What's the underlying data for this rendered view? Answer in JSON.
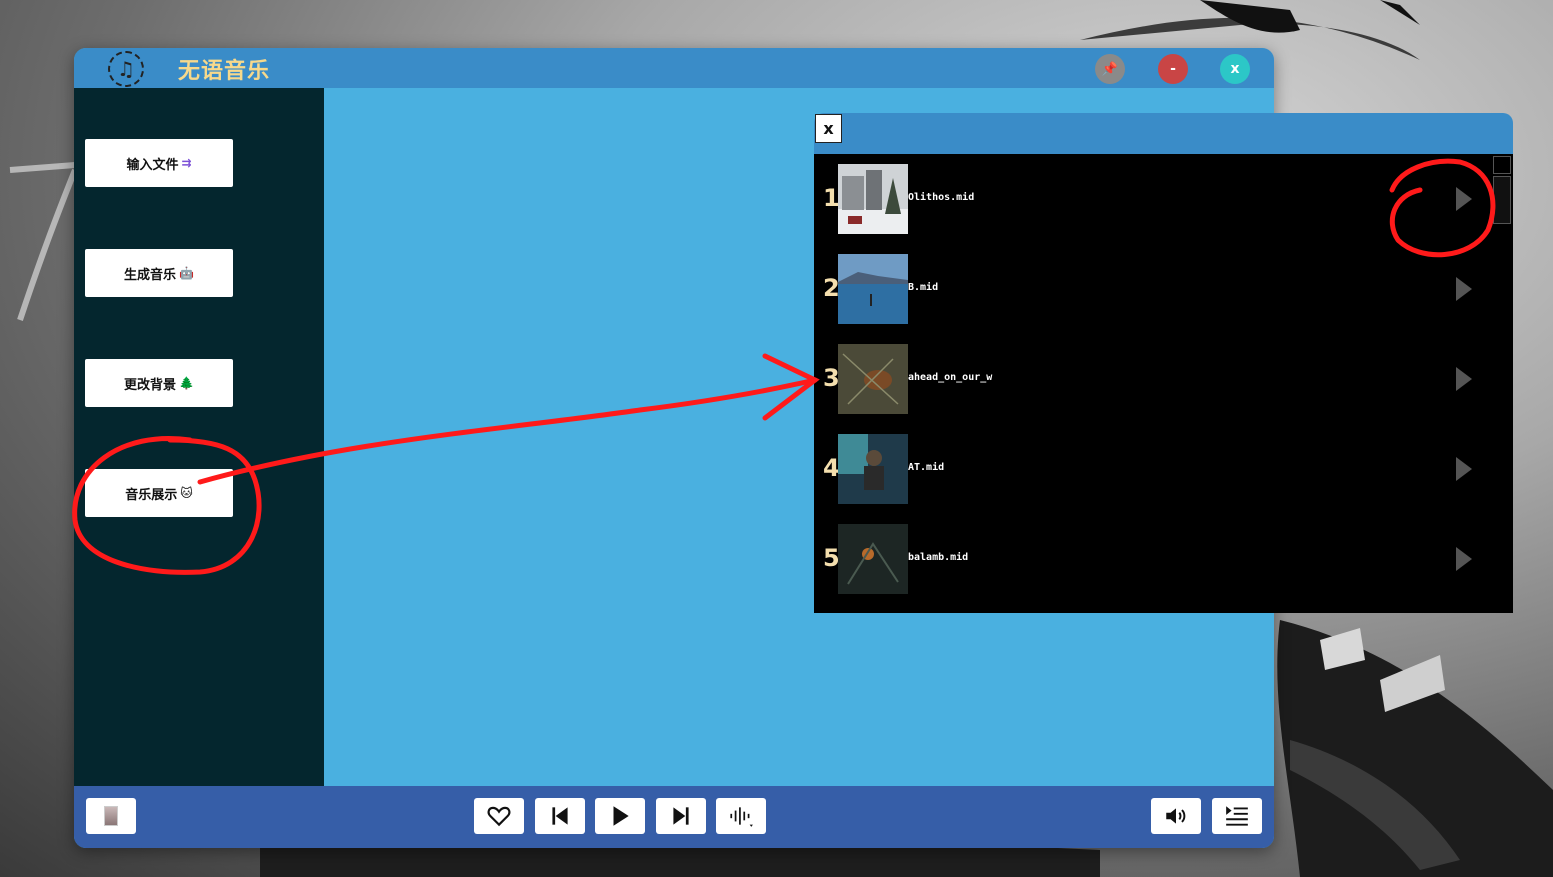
{
  "app": {
    "title": "无语音乐",
    "logo_icon": "♫",
    "titlebar_buttons": {
      "pin": "📌",
      "minimize": "-",
      "close": "x"
    }
  },
  "sidebar": {
    "items": [
      {
        "label": "输入文件",
        "emoji": "⇉"
      },
      {
        "label": "生成音乐",
        "emoji": "🤖"
      },
      {
        "label": "更改背景",
        "emoji": "🌲"
      },
      {
        "label": "音乐展示",
        "emoji": "🐱"
      }
    ]
  },
  "popup": {
    "close_label": "x",
    "songs": [
      {
        "num": "1",
        "name": "Olithos.mid"
      },
      {
        "num": "2",
        "name": "B.mid"
      },
      {
        "num": "3",
        "name": "ahead_on_our_w"
      },
      {
        "num": "4",
        "name": "AT.mid"
      },
      {
        "num": "5",
        "name": "balamb.mid"
      }
    ]
  },
  "player": {
    "icons": [
      "heart-icon",
      "previous-icon",
      "play-icon",
      "next-icon",
      "waveform-icon",
      "volume-icon",
      "playlist-icon"
    ]
  },
  "colors": {
    "titlebar": "#3a8cc8",
    "sidebar": "#04262e",
    "content": "#4ab0e0",
    "bottombar": "#365ea8",
    "title_text": "#f7d98b",
    "annotation": "#ff1a1a"
  }
}
